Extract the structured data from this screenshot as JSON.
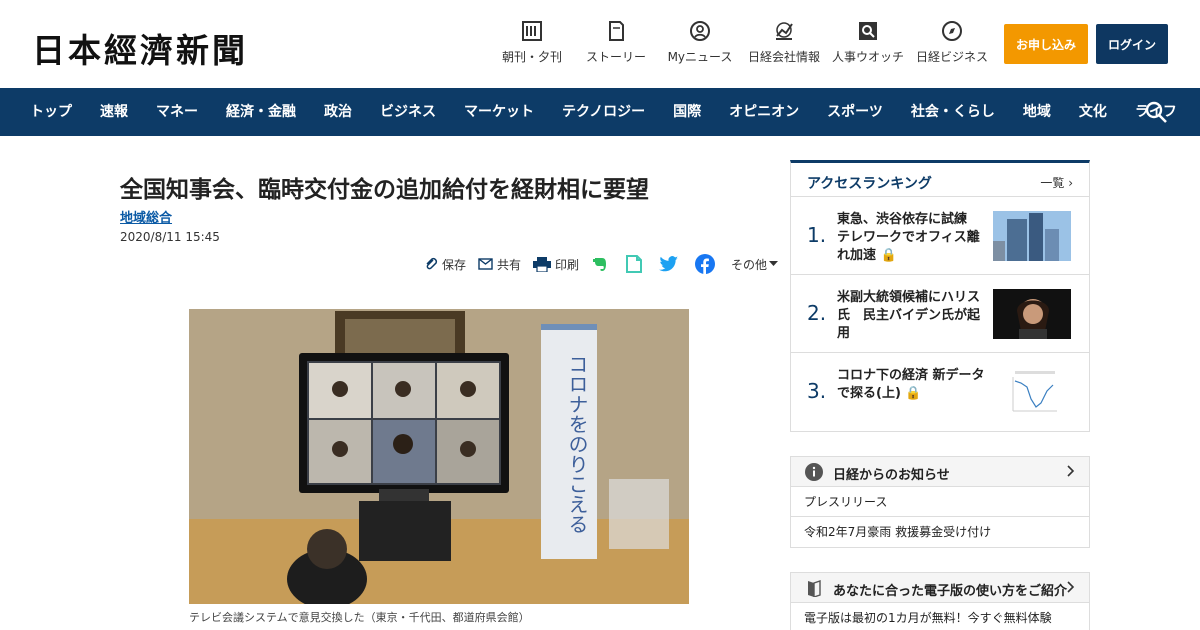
{
  "header": {
    "logo": "日本經濟新聞",
    "nav": [
      {
        "label": "朝刊・夕刊",
        "icon": "newspaper-icon"
      },
      {
        "label": "ストーリー",
        "icon": "story-icon"
      },
      {
        "label": "Myニュース",
        "icon": "user-icon"
      },
      {
        "label": "日経会社情報",
        "icon": "chart-icon"
      },
      {
        "label": "人事ウオッチ",
        "icon": "search-person-icon"
      },
      {
        "label": "日経ビジネス",
        "icon": "compass-icon"
      }
    ],
    "apply_label": "お申し込み",
    "login_label": "ログイン"
  },
  "mainnav": [
    "トップ",
    "速報",
    "マネー",
    "経済・金融",
    "政治",
    "ビジネス",
    "マーケット",
    "テクノロジー",
    "国際",
    "オピニオン",
    "スポーツ",
    "社会・くらし",
    "地域",
    "文化",
    "ライフ"
  ],
  "article": {
    "title": "全国知事会、臨時交付金の追加給付を経財相に要望",
    "category": "地域総合",
    "date": "2020/8/11 15:45",
    "tools": {
      "save": "保存",
      "share": "共有",
      "print": "印刷",
      "more": "その他"
    },
    "banner_text": "コロナをのりこえる",
    "caption": "テレビ会議システムで意見交換した（東京・千代田、都道府県会館）"
  },
  "ranking": {
    "title": "アクセスランキング",
    "more": "一覧",
    "items": [
      {
        "rank": "1.",
        "text": "東急、渋谷依存に試練　テレワークでオフィス離れ加速",
        "locked": true
      },
      {
        "rank": "2.",
        "text": "米副大統領候補にハリス氏　民主バイデン氏が起用",
        "locked": false
      },
      {
        "rank": "3.",
        "text": "コロナ下の経済 新データで探る(上)",
        "locked": true
      }
    ]
  },
  "notice": {
    "title": "日経からのお知らせ",
    "items": [
      "プレスリリース",
      "令和2年7月豪雨 救援募金受け付け"
    ]
  },
  "guide": {
    "title": "あなたに合った電子版の使い方をご紹介",
    "item": "電子版は最初の1カ月が無料！今すぐ無料体験"
  },
  "colors": {
    "navy": "#0d3b67",
    "orange": "#f39800",
    "link": "#0b5aa5"
  }
}
